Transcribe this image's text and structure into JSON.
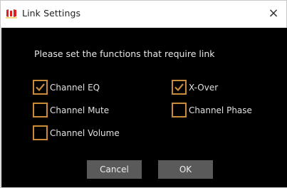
{
  "window": {
    "title": "Link Settings",
    "close_glyph": "×",
    "app_icon": "speaker-logo-icon"
  },
  "prompt": "Please set the functions that require link",
  "options": [
    {
      "label": "Channel EQ",
      "checked": true
    },
    {
      "label": "X-Over",
      "checked": true
    },
    {
      "label": "Channel Mute",
      "checked": false
    },
    {
      "label": "Channel Phase",
      "checked": false
    },
    {
      "label": "Channel Volume",
      "checked": false
    }
  ],
  "buttons": {
    "cancel": "Cancel",
    "ok": "OK"
  },
  "colors": {
    "accent": "#c98a3a",
    "dialog_bg": "#000000",
    "button_bg": "#5a5a5a",
    "logo_red": "#e02020"
  }
}
